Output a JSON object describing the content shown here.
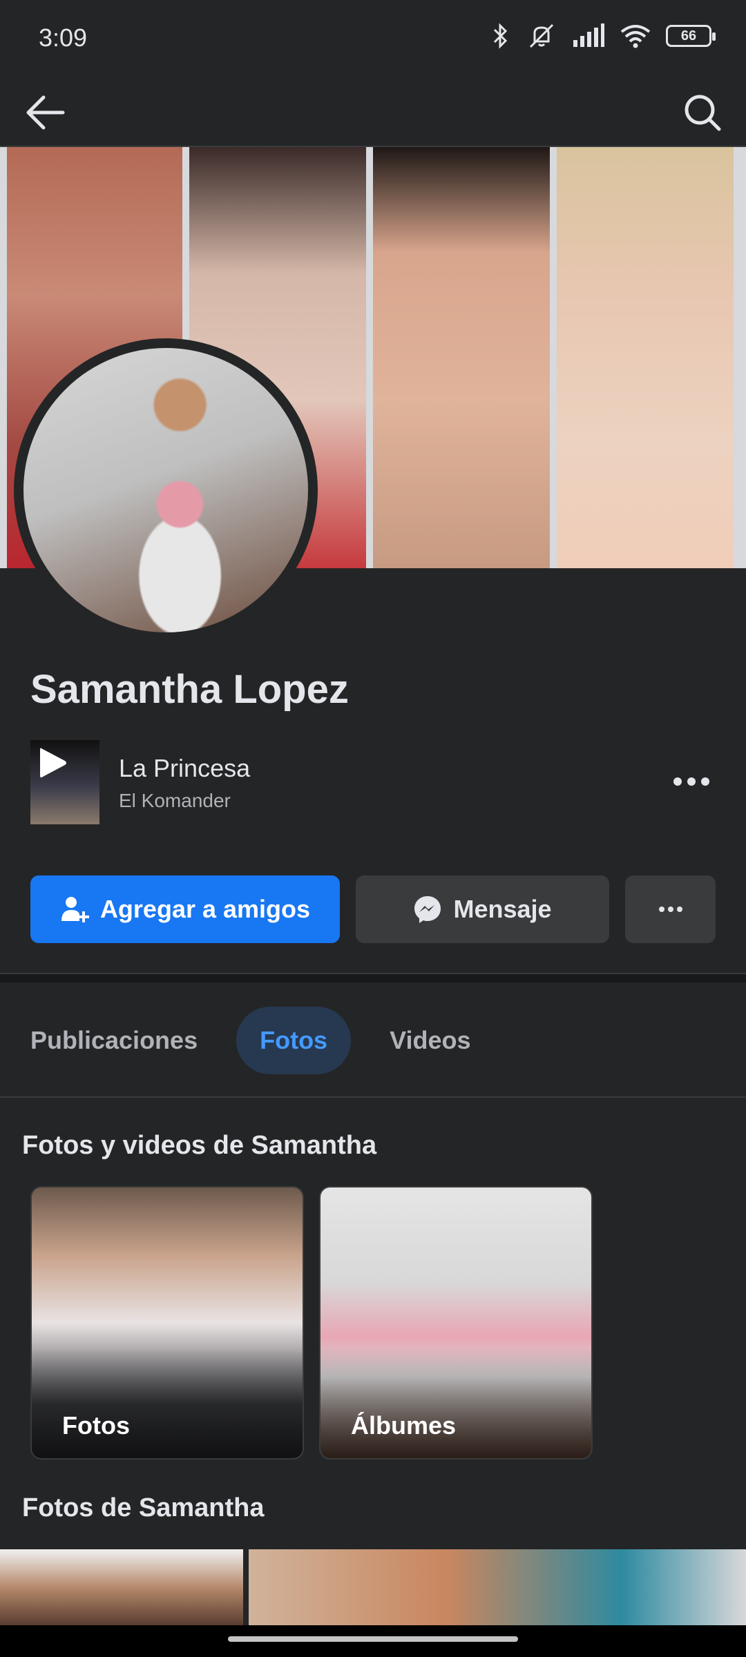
{
  "status_bar": {
    "time": "3:09",
    "battery": "66",
    "icons": [
      "bluetooth-icon",
      "mute-vibrate-icon",
      "signal-icon",
      "wifi-icon",
      "battery-icon"
    ]
  },
  "top_nav": {
    "back_icon": "arrow-left-icon",
    "search_icon": "search-icon"
  },
  "profile": {
    "name": "Samantha Lopez"
  },
  "music": {
    "title": "La Princesa",
    "artist": "El Komander",
    "play_icon": "play-icon",
    "more_icon": "more-horizontal-icon"
  },
  "actions": {
    "add_friend_label": "Agregar a amigos",
    "message_label": "Mensaje",
    "add_friend_icon": "person-add-icon",
    "message_icon": "messenger-icon",
    "more_icon": "more-horizontal-icon"
  },
  "tabs": [
    {
      "label": "Publicaciones",
      "selected": false
    },
    {
      "label": "Fotos",
      "selected": true
    },
    {
      "label": "Videos",
      "selected": false
    }
  ],
  "sections": {
    "photos_videos_title": "Fotos y videos de Samantha",
    "photos_title": "Fotos de Samantha"
  },
  "albums": [
    {
      "label": "Fotos"
    },
    {
      "label": "Álbumes"
    }
  ],
  "colors": {
    "background": "#242526",
    "primary": "#1877f2",
    "tab_selected_bg": "#263951",
    "tab_selected_text": "#4599ff",
    "secondary_button": "#3a3b3c"
  }
}
